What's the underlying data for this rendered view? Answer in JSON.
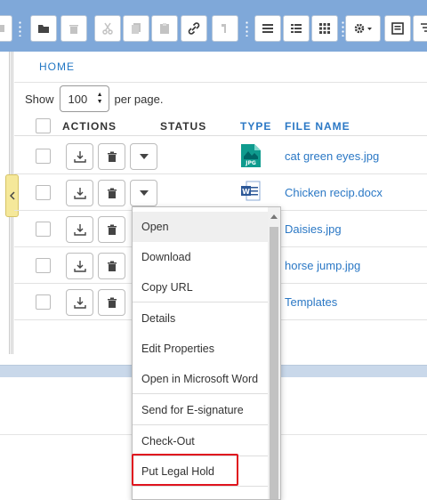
{
  "toolbar": {
    "buttons": [
      "new-folder-icon",
      "delete-icon",
      "cut-icon",
      "copy-icon",
      "paste-icon",
      "link-icon",
      "up-level-icon",
      "list-view-icon",
      "details-view-icon",
      "grid-view-icon",
      "settings-icon",
      "document-icon",
      "filter-icon"
    ]
  },
  "breadcrumb": {
    "home": "HOME"
  },
  "paging": {
    "show_label": "Show",
    "value": "100",
    "suffix": "per page."
  },
  "columns": {
    "actions": "ACTIONS",
    "status": "STATUS",
    "type": "TYPE",
    "file_name": "FILE NAME"
  },
  "files": [
    {
      "name": "cat green eyes.jpg",
      "type_icon": "jpg-file-icon",
      "type_label": "JPG"
    },
    {
      "name": "Chicken recip.docx",
      "type_icon": "word-file-icon",
      "type_label": "W"
    },
    {
      "name": "Daisies.jpg",
      "type_icon": ""
    },
    {
      "name": "horse jump.jpg",
      "type_icon": ""
    },
    {
      "name": "Templates",
      "type_icon": ""
    }
  ],
  "context_menu": {
    "items": [
      "Open",
      "Download",
      "Copy URL",
      "Details",
      "Edit Properties",
      "Open in Microsoft Word",
      "Send for E-signature",
      "Check-Out",
      "Put Legal Hold"
    ],
    "highlighted": "Put Legal Hold"
  },
  "colors": {
    "toolbar": "#7fa8d9",
    "link": "#2b78c5",
    "highlight_box": "#e0141e"
  }
}
